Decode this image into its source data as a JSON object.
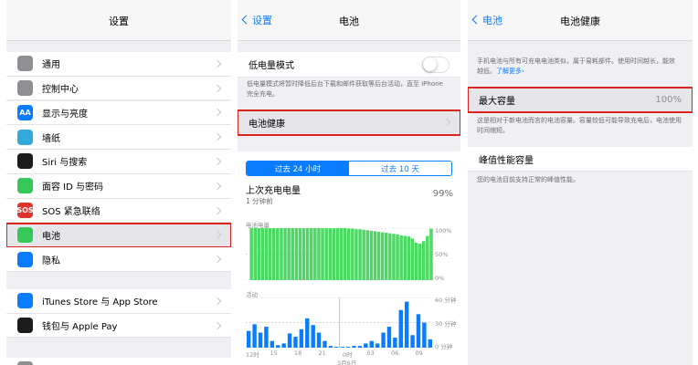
{
  "colors": {
    "accent": "#0a7cff",
    "highlight": "#d9261c",
    "battery_green": "#4cd964",
    "activity_blue": "#0a7cff"
  },
  "settings": {
    "title": "设置",
    "group1": [
      {
        "label": "通用",
        "icon": "gear-icon",
        "color": "#8e8e93"
      },
      {
        "label": "控制中心",
        "icon": "toggles-icon",
        "color": "#8e8e93"
      },
      {
        "label": "显示与亮度",
        "icon": "aa-icon",
        "color": "#0a7cff",
        "text": "AA"
      },
      {
        "label": "墙纸",
        "icon": "flower-icon",
        "color": "#32aadc"
      },
      {
        "label": "Siri 与搜索",
        "icon": "siri-icon",
        "color": "#1c1c1e"
      },
      {
        "label": "面容 ID 与密码",
        "icon": "face-id-icon",
        "color": "#34c759"
      },
      {
        "label": "SOS 紧急联络",
        "icon": "sos-icon",
        "color": "#e0332c",
        "text": "SOS"
      },
      {
        "label": "电池",
        "icon": "battery-icon",
        "color": "#34c759"
      },
      {
        "label": "隐私",
        "icon": "hand-icon",
        "color": "#0a7cff"
      }
    ],
    "group2": [
      {
        "label": "iTunes Store 与 App Store",
        "icon": "app-store-icon",
        "color": "#0a7cff"
      },
      {
        "label": "钱包与 Apple Pay",
        "icon": "wallet-icon",
        "color": "#1c1c1e"
      }
    ]
  },
  "battery": {
    "back": "设置",
    "title": "电池",
    "low_power_label": "低电量模式",
    "low_power_note": "低电量模式将暂时降低后台下载和邮件获取等后台活动，直至 iPhone 完全充电。",
    "health_label": "电池健康",
    "tabs": [
      "过去 24 小时",
      "过去 10 天"
    ],
    "last_charge_label": "上次充电电量",
    "last_charge_time": "1 分钟前",
    "last_charge_value": "99%",
    "level_title": "电池电量",
    "level_ticks": [
      "100%",
      "50%",
      "0%"
    ],
    "activity_title": "活动",
    "activity_ticks": [
      "60 分钟",
      "30 分钟",
      "0 分钟"
    ],
    "x_ticks": [
      "12时",
      "15",
      "18",
      "21",
      "0时",
      "03",
      "06",
      "09"
    ],
    "date_label": "3月6日"
  },
  "chart_data": [
    {
      "type": "area",
      "title": "电池电量",
      "ylim": [
        0,
        100
      ],
      "yticks": [
        "100%",
        "50%",
        "0%"
      ],
      "values": [
        0,
        100,
        100,
        100,
        100,
        100,
        100,
        100,
        100,
        100,
        100,
        100,
        100,
        100,
        100,
        100,
        100,
        100,
        100,
        100,
        100,
        100,
        100,
        100,
        100,
        100,
        100,
        99,
        99,
        98,
        98,
        97,
        96,
        95,
        94,
        93,
        92,
        91,
        90,
        89,
        88,
        86,
        85,
        84,
        80,
        72,
        70,
        75,
        85,
        99
      ]
    },
    {
      "type": "bar",
      "title": "活动",
      "ylim": [
        0,
        60
      ],
      "yticks": [
        "60 分钟",
        "30 分钟",
        "0 分钟"
      ],
      "values": [
        20,
        28,
        18,
        25,
        8,
        3,
        5,
        17,
        13,
        22,
        35,
        27,
        18,
        8,
        2,
        1,
        1,
        1,
        2,
        2,
        5,
        8,
        5,
        18,
        25,
        12,
        45,
        55,
        15,
        40,
        30,
        10
      ]
    }
  ],
  "health": {
    "back": "电池",
    "title": "电池健康",
    "intro": "手机电池与所有可充电电池类似，属于易耗部件。使用时间越长，能效越低。",
    "learn_more": "了解更多",
    "max_capacity_label": "最大容量",
    "max_capacity_value": "100%",
    "max_capacity_note": "这是相对于新电池而言的电池容量。容量较低可能导致充电后，电池使用时间缩短。",
    "peak_label": "峰值性能容量",
    "peak_note": "您的电池目前支持正常的峰值性能。"
  }
}
